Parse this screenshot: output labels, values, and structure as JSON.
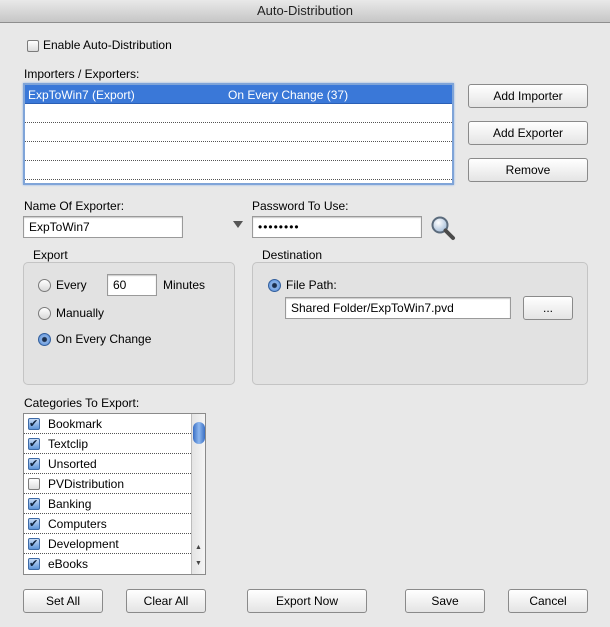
{
  "window": {
    "title": "Auto-Distribution"
  },
  "enable": {
    "label": "Enable Auto-Distribution",
    "checked": false
  },
  "importers": {
    "label": "Importers / Exporters:",
    "rows": [
      {
        "name": "ExpToWin7 (Export)",
        "trigger": "On Every Change (37)",
        "selected": true
      },
      {
        "name": "",
        "trigger": ""
      },
      {
        "name": "",
        "trigger": ""
      },
      {
        "name": "",
        "trigger": ""
      },
      {
        "name": "",
        "trigger": ""
      }
    ],
    "add_importer": "Add Importer",
    "add_exporter": "Add Exporter",
    "remove": "Remove"
  },
  "exporter_name": {
    "label": "Name Of Exporter:",
    "value": "ExpToWin7"
  },
  "password": {
    "label": "Password To Use:",
    "value": "••••••••"
  },
  "export": {
    "title": "Export",
    "every_label": "Every",
    "every_value": "60",
    "minutes_label": "Minutes",
    "manually_label": "Manually",
    "on_change_label": "On Every Change",
    "selected": "on_change"
  },
  "destination": {
    "title": "Destination",
    "file_path_label": "File Path:",
    "file_path_value": "Shared Folder/ExpToWin7.pvd",
    "browse_label": "..."
  },
  "categories": {
    "label": "Categories To Export:",
    "items": [
      {
        "name": "Bookmark",
        "checked": true
      },
      {
        "name": "Textclip",
        "checked": true
      },
      {
        "name": "Unsorted",
        "checked": true
      },
      {
        "name": "PVDistribution",
        "checked": false
      },
      {
        "name": "Banking",
        "checked": true
      },
      {
        "name": "Computers",
        "checked": true
      },
      {
        "name": "Development",
        "checked": true
      },
      {
        "name": "eBooks",
        "checked": true
      }
    ]
  },
  "footer": {
    "set_all": "Set All",
    "clear_all": "Clear All",
    "export_now": "Export Now",
    "save": "Save",
    "cancel": "Cancel"
  },
  "colors": {
    "selection": "#3a78d8",
    "focus_ring": "#7fa4d8"
  }
}
